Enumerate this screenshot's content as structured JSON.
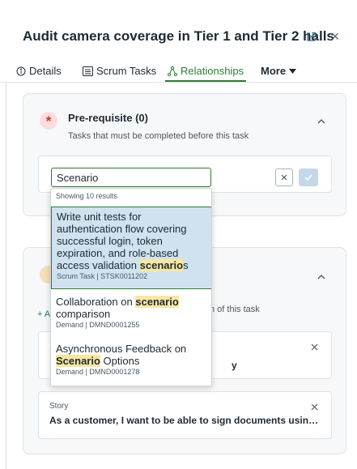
{
  "header": {
    "title": "Audit camera coverage in Tier 1 and Tier 2 halls",
    "open_icon": "external-link-icon",
    "close_icon": "close-icon"
  },
  "tabs": [
    {
      "label": "Details",
      "icon": "info-icon"
    },
    {
      "label": "Scrum Tasks",
      "icon": "list-icon"
    },
    {
      "label": "Relationships",
      "icon": "relationship-icon",
      "active": true
    },
    {
      "label": "More",
      "icon": "caret-down-icon"
    }
  ],
  "prerequisite": {
    "badge": "*",
    "title": "Pre-requisite (0)",
    "subtitle": "Tasks that must be completed before this task",
    "search_value": "Scenario"
  },
  "dropdown": {
    "count_text": "Showing 10 results",
    "results": [
      {
        "pre": "Write unit tests for authentication flow covering successful login, token expiration, and role-based access validation ",
        "match": "scenario",
        "post": "s",
        "meta": "Scrum Task | STSK0011202"
      },
      {
        "pre": "Collaboration on ",
        "match": "scenario",
        "post": " comparison",
        "meta": "Demand | DMND0001255"
      },
      {
        "pre": "Asynchronous Feedback on ",
        "match": "Scenario",
        "post": " Options",
        "meta": "Demand | DMND0001278"
      }
    ]
  },
  "second_panel": {
    "subtitle_fragment": "n of this task",
    "add_fragment": "+ A",
    "cards": [
      {
        "type": "",
        "text": "y"
      },
      {
        "type": "Story",
        "text": "As a customer, I want to be able to sign documents using ..."
      }
    ]
  },
  "colors": {
    "accent": "#2e7d32",
    "highlight": "#f7e7a1",
    "selected_bg": "#cfe2ee",
    "confirm_bg": "#c3d9e9"
  }
}
